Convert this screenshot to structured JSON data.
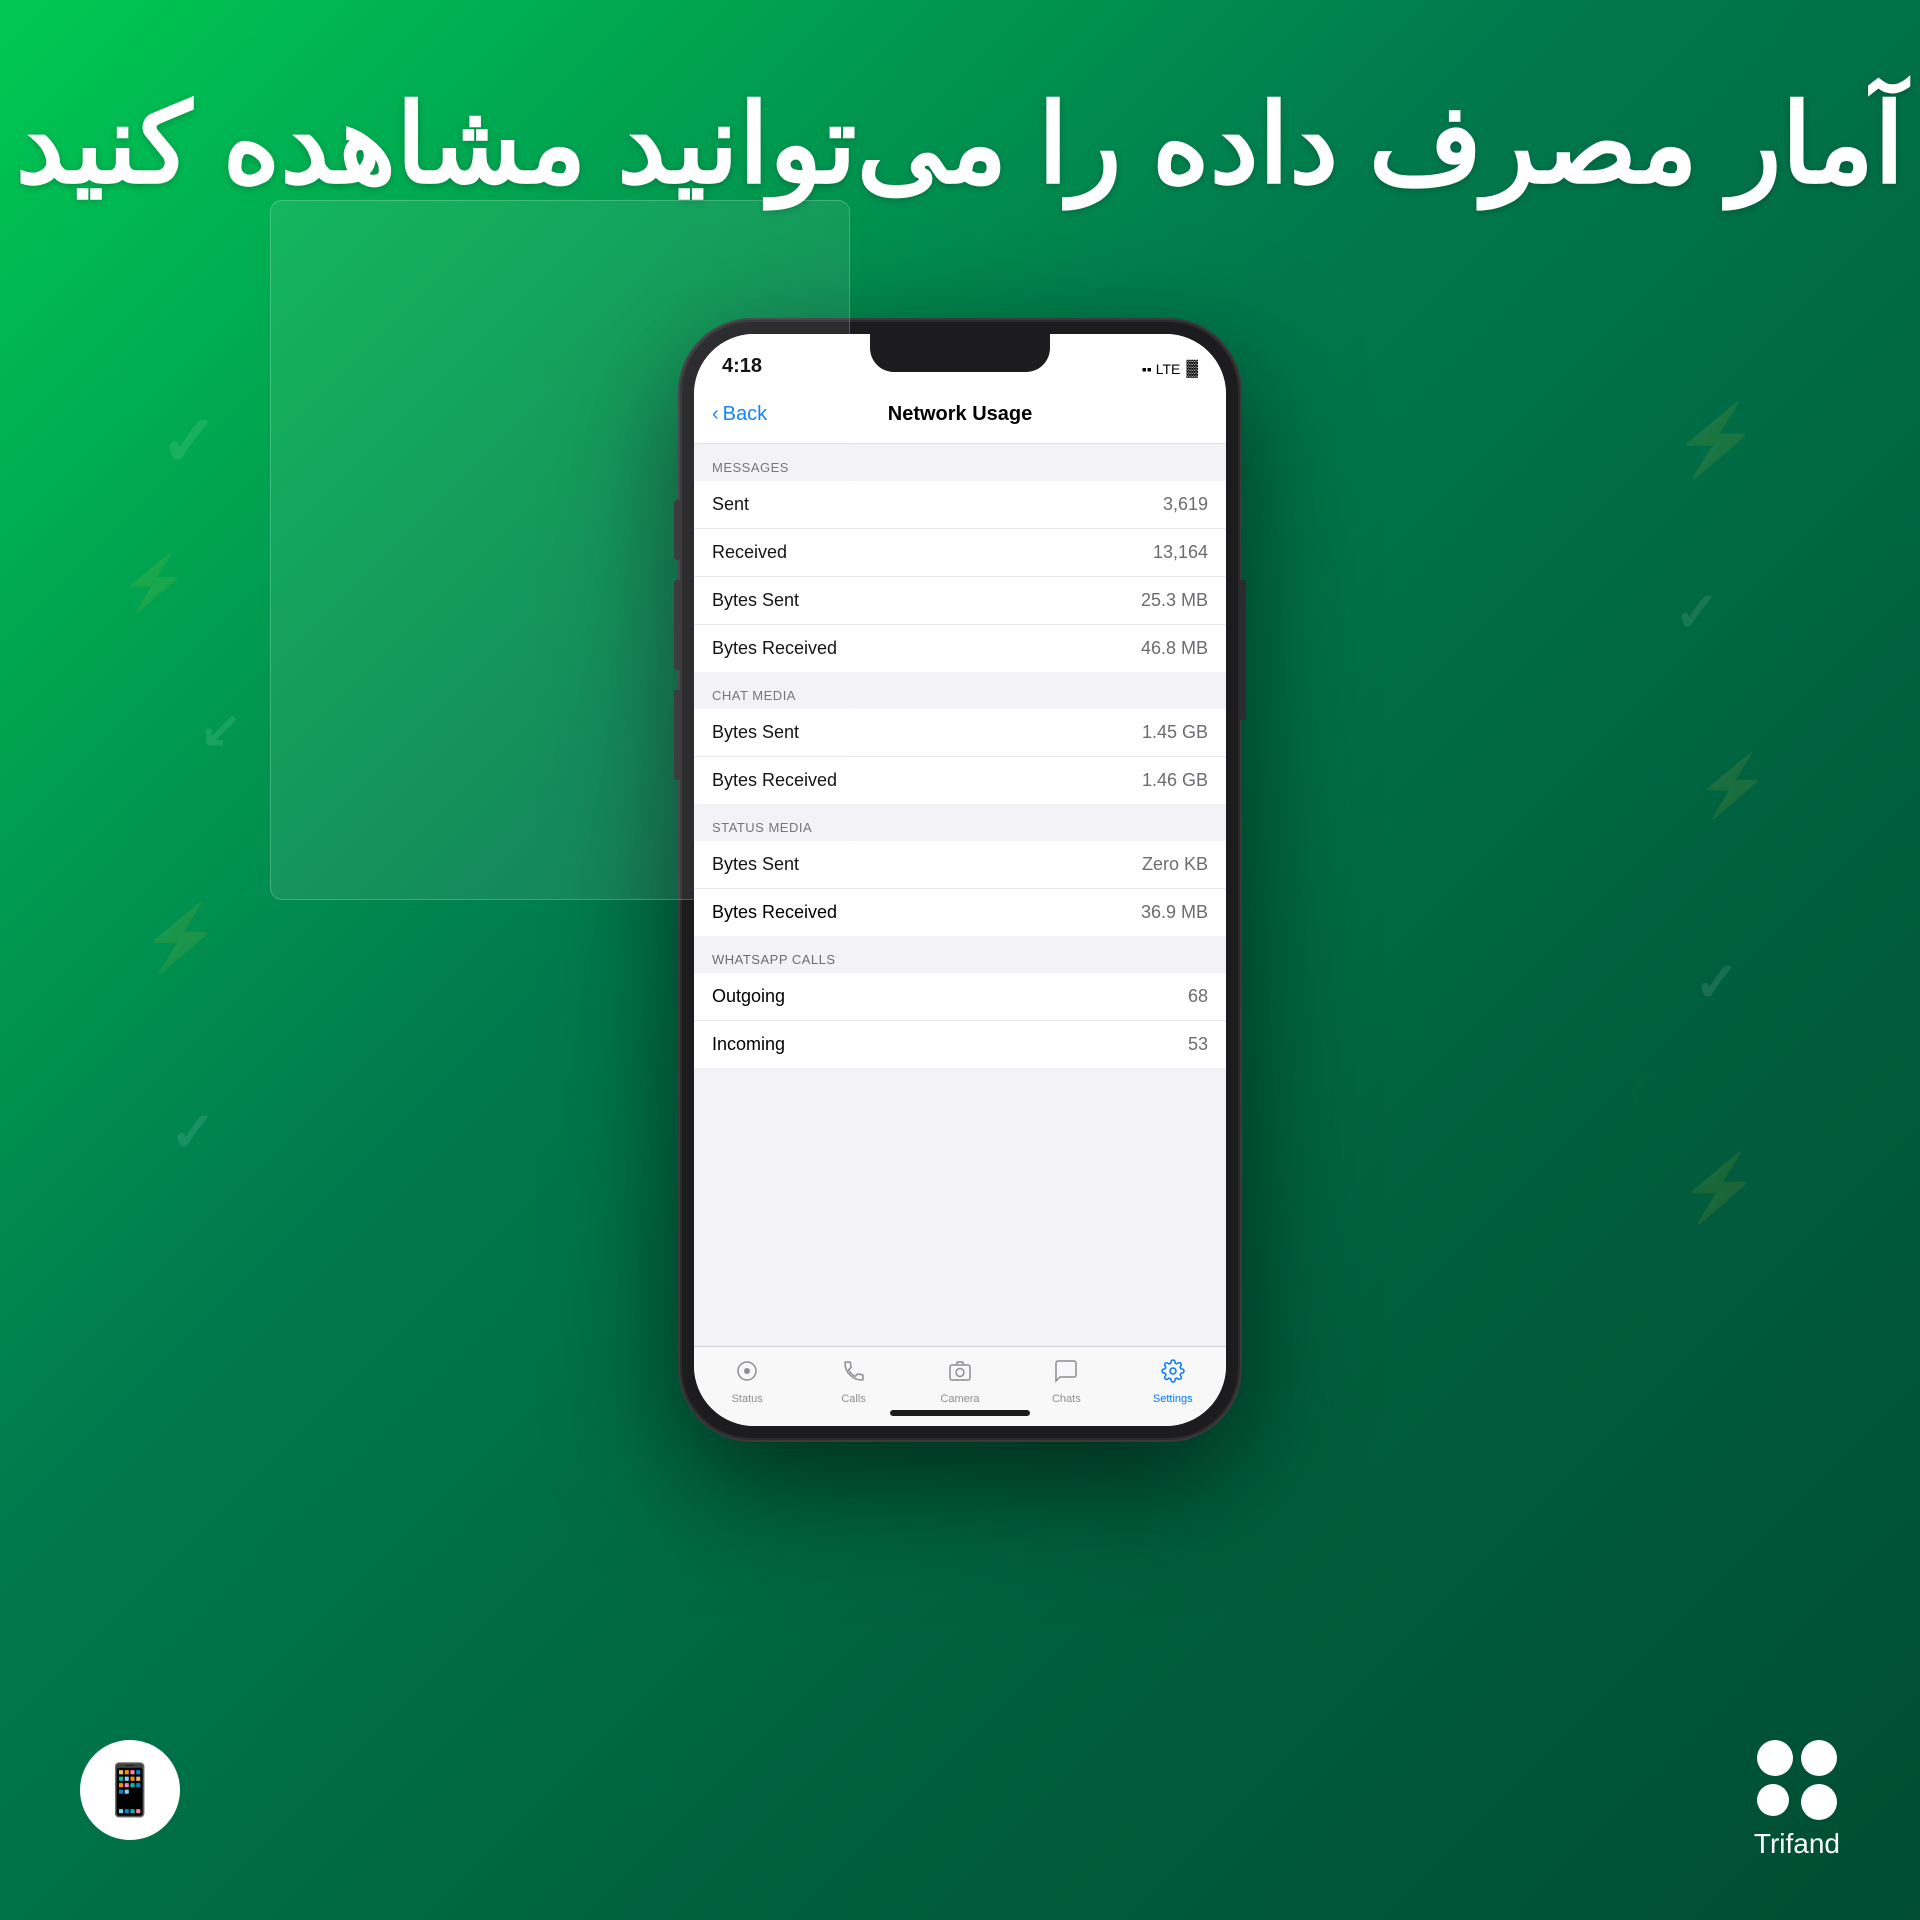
{
  "background": {
    "gradient_start": "#00c853",
    "gradient_end": "#004d33"
  },
  "heading": {
    "text": "آمار مصرف داده را می‌توانید مشاهده کنید"
  },
  "phone": {
    "status_bar": {
      "time": "4:18",
      "signal": "▪▪ LTE",
      "battery": "🔋"
    },
    "nav": {
      "back_label": "Back",
      "title": "Network Usage"
    },
    "sections": [
      {
        "id": "messages",
        "header": "MESSAGES",
        "rows": [
          {
            "label": "Sent",
            "value": "3,619"
          },
          {
            "label": "Received",
            "value": "13,164"
          },
          {
            "label": "Bytes Sent",
            "value": "25.3 MB"
          },
          {
            "label": "Bytes Received",
            "value": "46.8 MB"
          }
        ]
      },
      {
        "id": "chat_media",
        "header": "CHAT MEDIA",
        "rows": [
          {
            "label": "Bytes Sent",
            "value": "1.45 GB"
          },
          {
            "label": "Bytes Received",
            "value": "1.46 GB"
          }
        ]
      },
      {
        "id": "status_media",
        "header": "STATUS MEDIA",
        "rows": [
          {
            "label": "Bytes Sent",
            "value": "Zero KB"
          },
          {
            "label": "Bytes Received",
            "value": "36.9 MB"
          }
        ]
      },
      {
        "id": "whatsapp_calls",
        "header": "WHATSAPP CALLS",
        "rows": [
          {
            "label": "Outgoing",
            "value": "68"
          },
          {
            "label": "Incoming",
            "value": "53"
          }
        ]
      }
    ],
    "tab_bar": {
      "items": [
        {
          "id": "status",
          "label": "Status",
          "icon": "⊙",
          "active": false
        },
        {
          "id": "calls",
          "label": "Calls",
          "icon": "✆",
          "active": false
        },
        {
          "id": "camera",
          "label": "Camera",
          "icon": "◎",
          "active": false
        },
        {
          "id": "chats",
          "label": "Chats",
          "icon": "◻",
          "active": false
        },
        {
          "id": "settings",
          "label": "Settings",
          "icon": "⚙",
          "active": true
        }
      ]
    }
  },
  "branding": {
    "logo_name": "Trifand",
    "phone_icon": "📱"
  }
}
